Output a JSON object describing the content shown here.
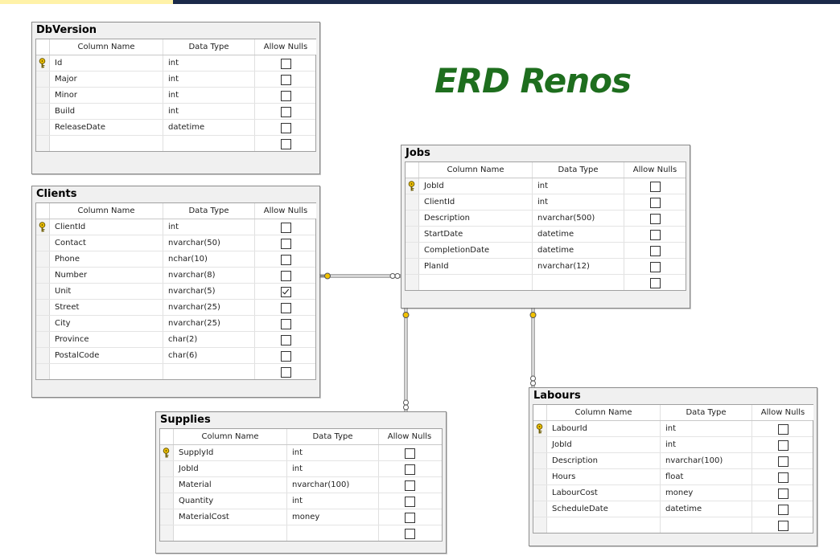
{
  "title": "ERD Renos",
  "headers": {
    "column_name": "Column Name",
    "data_type": "Data Type",
    "allow_nulls": "Allow Nulls"
  },
  "colors": {
    "title": "#1e6e1e",
    "key": "#f2c200",
    "connector": "#6a6a6a"
  },
  "tables": {
    "dbversion": {
      "name": "DbVersion",
      "columns": [
        {
          "name": "Id",
          "type": "int",
          "nulls": false,
          "pk": true
        },
        {
          "name": "Major",
          "type": "int",
          "nulls": false
        },
        {
          "name": "Minor",
          "type": "int",
          "nulls": false
        },
        {
          "name": "Build",
          "type": "int",
          "nulls": false
        },
        {
          "name": "ReleaseDate",
          "type": "datetime",
          "nulls": false
        }
      ]
    },
    "clients": {
      "name": "Clients",
      "columns": [
        {
          "name": "ClientId",
          "type": "int",
          "nulls": false,
          "pk": true
        },
        {
          "name": "Contact",
          "type": "nvarchar(50)",
          "nulls": false
        },
        {
          "name": "Phone",
          "type": "nchar(10)",
          "nulls": false
        },
        {
          "name": "Number",
          "type": "nvarchar(8)",
          "nulls": false
        },
        {
          "name": "Unit",
          "type": "nvarchar(5)",
          "nulls": true
        },
        {
          "name": "Street",
          "type": "nvarchar(25)",
          "nulls": false
        },
        {
          "name": "City",
          "type": "nvarchar(25)",
          "nulls": false
        },
        {
          "name": "Province",
          "type": "char(2)",
          "nulls": false
        },
        {
          "name": "PostalCode",
          "type": "char(6)",
          "nulls": false
        }
      ]
    },
    "jobs": {
      "name": "Jobs",
      "columns": [
        {
          "name": "JobId",
          "type": "int",
          "nulls": false,
          "pk": true
        },
        {
          "name": "ClientId",
          "type": "int",
          "nulls": false
        },
        {
          "name": "Description",
          "type": "nvarchar(500)",
          "nulls": false
        },
        {
          "name": "StartDate",
          "type": "datetime",
          "nulls": false
        },
        {
          "name": "CompletionDate",
          "type": "datetime",
          "nulls": false
        },
        {
          "name": "PlanId",
          "type": "nvarchar(12)",
          "nulls": false
        }
      ]
    },
    "supplies": {
      "name": "Supplies",
      "columns": [
        {
          "name": "SupplyId",
          "type": "int",
          "nulls": false,
          "pk": true
        },
        {
          "name": "JobId",
          "type": "int",
          "nulls": false
        },
        {
          "name": "Material",
          "type": "nvarchar(100)",
          "nulls": false
        },
        {
          "name": "Quantity",
          "type": "int",
          "nulls": false
        },
        {
          "name": "MaterialCost",
          "type": "money",
          "nulls": false
        }
      ]
    },
    "labours": {
      "name": "Labours",
      "columns": [
        {
          "name": "LabourId",
          "type": "int",
          "nulls": false,
          "pk": true
        },
        {
          "name": "JobId",
          "type": "int",
          "nulls": false
        },
        {
          "name": "Description",
          "type": "nvarchar(100)",
          "nulls": false
        },
        {
          "name": "Hours",
          "type": "float",
          "nulls": false
        },
        {
          "name": "LabourCost",
          "type": "money",
          "nulls": false
        },
        {
          "name": "ScheduleDate",
          "type": "datetime",
          "nulls": false
        }
      ]
    }
  }
}
